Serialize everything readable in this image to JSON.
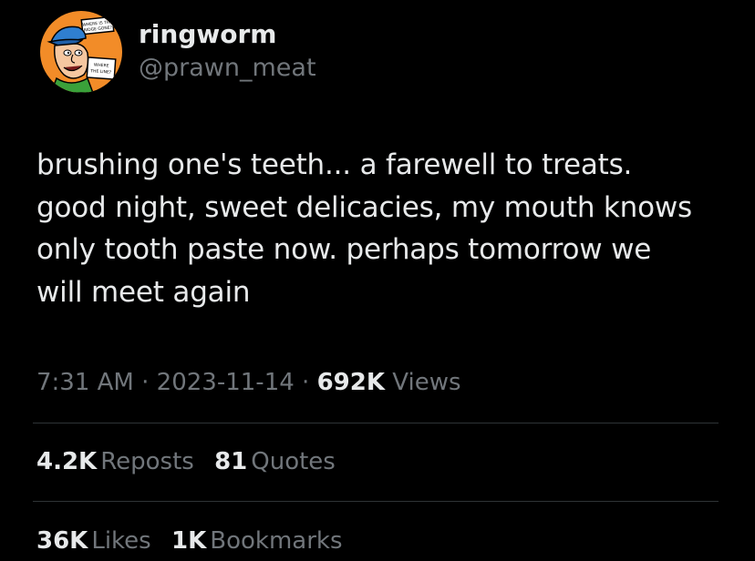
{
  "author": {
    "display_name": "ringworm",
    "handle": "@prawn_meat",
    "avatar_sign_top": "WHERE IS THE RIDGE GONE?",
    "avatar_sign_bottom": "WHERE THE LINE?"
  },
  "tweet": {
    "text": "brushing one's teeth... a farewell to treats.\ngood night, sweet delicacies, my mouth knows\nonly tooth paste now. perhaps tomorrow we\nwill meet again"
  },
  "meta": {
    "time": "7:31 AM",
    "separator": "·",
    "date": "2023-11-14",
    "views_count": "692K",
    "views_label": "Views"
  },
  "stats": {
    "reposts_count": "4.2K",
    "reposts_label": "Reposts",
    "quotes_count": "81",
    "quotes_label": "Quotes",
    "likes_count": "36K",
    "likes_label": "Likes",
    "bookmarks_count": "1K",
    "bookmarks_label": "Bookmarks"
  },
  "colors": {
    "background": "#000000",
    "primary_text": "#e7e9ea",
    "secondary_text": "#71767b",
    "divider": "#2f3336",
    "avatar_bg": "#f28c28"
  }
}
